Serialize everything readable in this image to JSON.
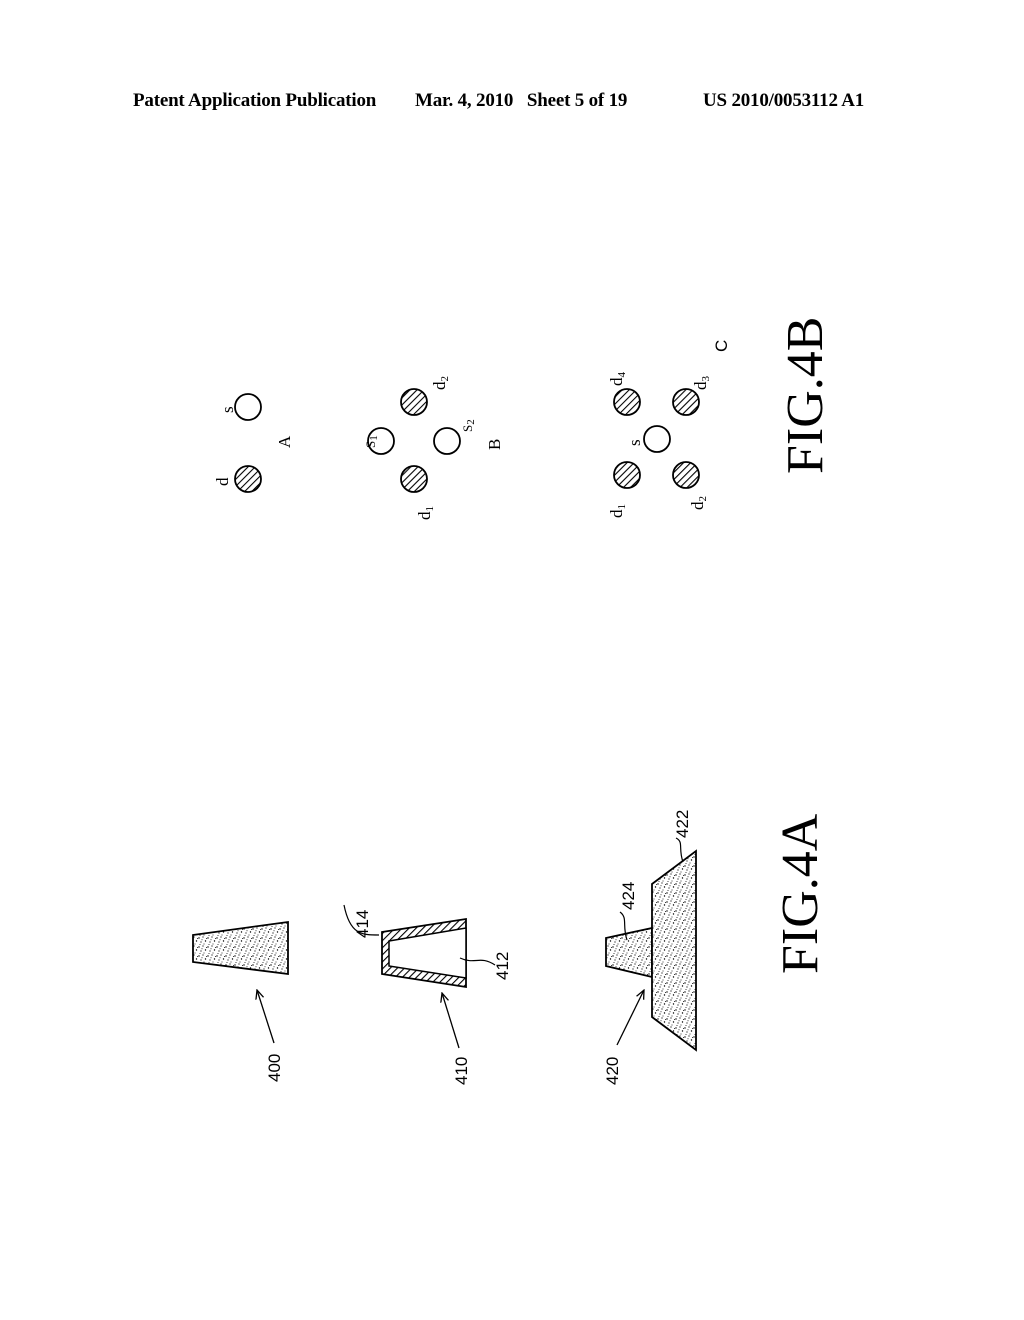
{
  "header": {
    "publication": "Patent Application Publication",
    "date_sheet": "Mar. 4, 2010   Sheet 5 of 19",
    "number": "US 2010/0053112 A1"
  },
  "fig4a": {
    "caption": "FIG.4A",
    "refs": {
      "r400": "400",
      "r410": "410",
      "r412": "412",
      "r414": "414",
      "r420": "420",
      "r422": "422",
      "r424": "424"
    }
  },
  "fig4b": {
    "caption": "FIG.4B",
    "groups": {
      "A": {
        "label": "A",
        "source": "s",
        "detector": "d"
      },
      "B": {
        "label": "B",
        "s1": "S",
        "s1_sub": "1",
        "s2": "S",
        "s2_sub": "2",
        "d1": "d",
        "d1_sub": "1",
        "d2": "d",
        "d2_sub": "2"
      },
      "C": {
        "label": "C",
        "source": "s",
        "d1": "d",
        "d1_sub": "1",
        "d2": "d",
        "d2_sub": "2",
        "d3": "d",
        "d3_sub": "3",
        "d4": "d",
        "d4_sub": "4"
      }
    }
  }
}
